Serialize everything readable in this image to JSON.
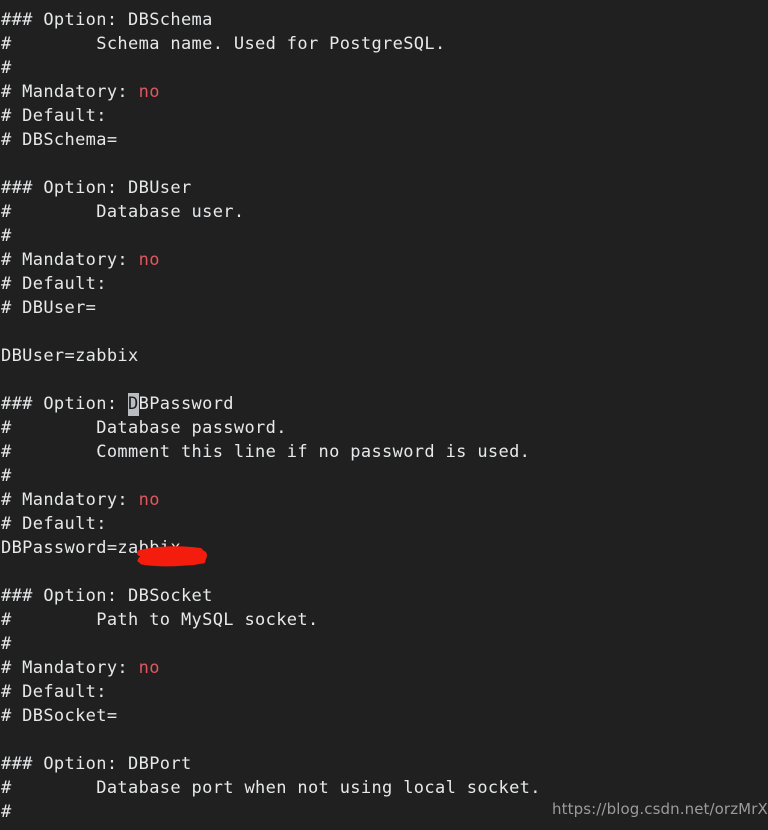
{
  "terminal": {
    "background_color": "#202020",
    "foreground_color": "#e6e8ea",
    "accent_value_color": "#e0575f",
    "cursor_color": "#b9bdc2",
    "redaction_color": "#f41c0c",
    "cursor": {
      "line_index": 16,
      "char": "D",
      "on_text": "DBPassword"
    },
    "lines": [
      {
        "id": "l0",
        "text": "### Option: DBSchema"
      },
      {
        "id": "l1",
        "text": "#        Schema name. Used for PostgreSQL."
      },
      {
        "id": "l2",
        "text": "#"
      },
      {
        "id": "l3",
        "pre": "# Mandatory: ",
        "value": "no"
      },
      {
        "id": "l4",
        "text": "# Default:"
      },
      {
        "id": "l5",
        "text": "# DBSchema="
      },
      {
        "id": "l6",
        "text": ""
      },
      {
        "id": "l7",
        "text": "### Option: DBUser"
      },
      {
        "id": "l8",
        "text": "#        Database user."
      },
      {
        "id": "l9",
        "text": "#"
      },
      {
        "id": "l10",
        "pre": "# Mandatory: ",
        "value": "no"
      },
      {
        "id": "l11",
        "text": "# Default:"
      },
      {
        "id": "l12",
        "text": "# DBUser="
      },
      {
        "id": "l13",
        "text": ""
      },
      {
        "id": "l14",
        "text": "DBUser=zabbix"
      },
      {
        "id": "l15",
        "text": ""
      },
      {
        "id": "l16",
        "pre": "### Option: ",
        "cursor_char": "D",
        "post": "BPassword"
      },
      {
        "id": "l17",
        "text": "#        Database password."
      },
      {
        "id": "l18",
        "text": "#        Comment this line if no password is used."
      },
      {
        "id": "l19",
        "text": "#"
      },
      {
        "id": "l20",
        "pre": "# Mandatory: ",
        "value": "no"
      },
      {
        "id": "l21",
        "text": "# Default:"
      },
      {
        "id": "l22",
        "text": "DBPassword=zabbix"
      },
      {
        "id": "l23",
        "text": ""
      },
      {
        "id": "l24",
        "text": "### Option: DBSocket"
      },
      {
        "id": "l25",
        "text": "#        Path to MySQL socket."
      },
      {
        "id": "l26",
        "text": "#"
      },
      {
        "id": "l27",
        "pre": "# Mandatory: ",
        "value": "no"
      },
      {
        "id": "l28",
        "text": "# Default:"
      },
      {
        "id": "l29",
        "text": "# DBSocket="
      },
      {
        "id": "l30",
        "text": ""
      },
      {
        "id": "l31",
        "text": "### Option: DBPort"
      },
      {
        "id": "l32",
        "text": "#        Database port when not using local socket."
      },
      {
        "id": "l33",
        "text": "#"
      }
    ]
  },
  "watermark": {
    "text": "https://blog.csdn.net/orzMrXu"
  }
}
